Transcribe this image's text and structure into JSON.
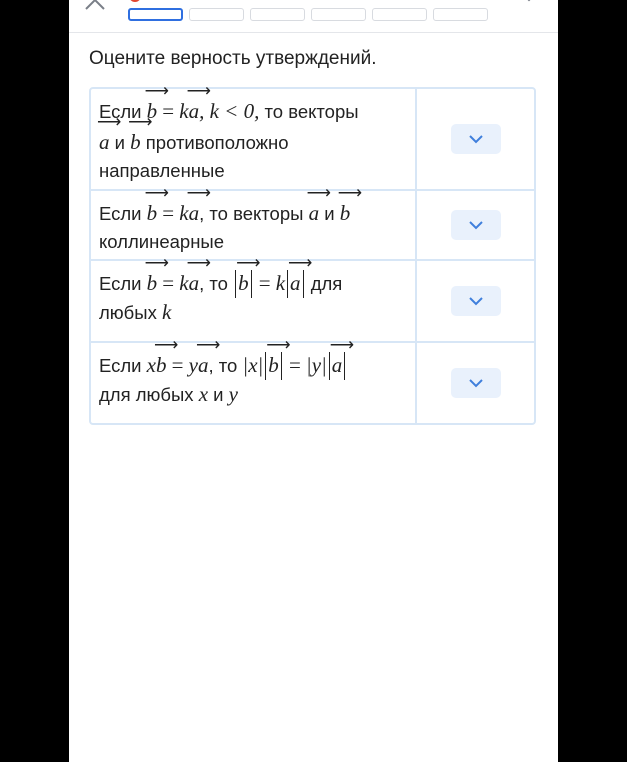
{
  "header": {
    "steps": [
      "",
      "",
      "",
      "",
      "",
      ""
    ],
    "active_step": 1
  },
  "prompt": "Оцените верность утверждений.",
  "rows": [
    {
      "text_if": "Если",
      "vec_b": "b",
      "eq": "=",
      "k": "k",
      "vec_a": "a",
      "cond": ", k < 0,",
      "then": "то векторы",
      "and": "и",
      "opposite": "противоположно",
      "directed": "направленные"
    },
    {
      "text_if": "Если",
      "vec_b": "b",
      "eq": "=",
      "k": "k",
      "vec_a": "a",
      "then": ", то векторы",
      "and": "и",
      "collinear": "коллинеарные"
    },
    {
      "text_if": "Если",
      "vec_b": "b",
      "eq": "=",
      "k": "k",
      "vec_a": "a",
      "then": ", то",
      "for": "для",
      "any": "любых",
      "var": "k"
    },
    {
      "text_if": "Если",
      "x": "x",
      "vec_b": "b",
      "eq": "=",
      "y": "y",
      "vec_a": "a",
      "then": ", то",
      "abs_x": "|x|",
      "abs_y": "|y|",
      "for_any": "для любых",
      "vars_x": "x",
      "vars_and": "и",
      "vars_y": "y"
    }
  ],
  "colors": {
    "accent": "#2f6fe0",
    "border": "#d7e6f6",
    "dropdown_bg": "#e9f1fc",
    "dropdown_chevron": "#3f7fdc",
    "badge": "#e2462f"
  }
}
